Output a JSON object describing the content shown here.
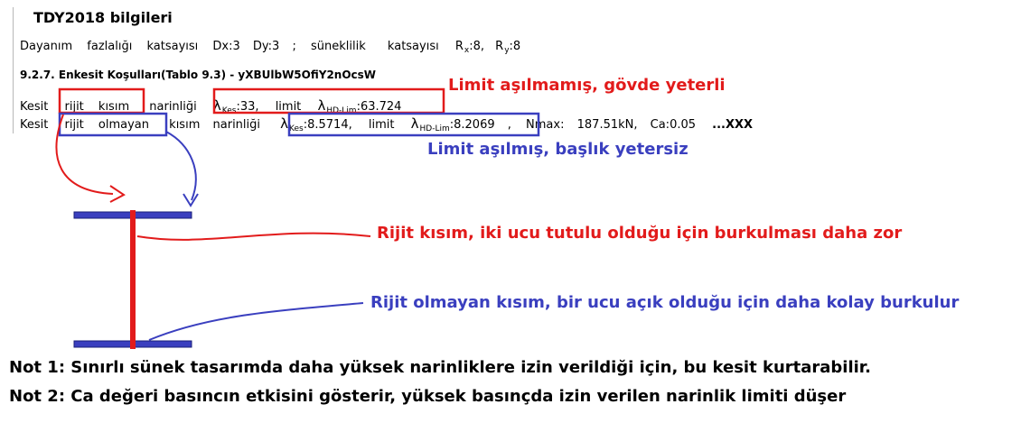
{
  "header": {
    "title": "TDY2018 bilgileri",
    "line1": {
      "label_words": [
        "Dayanım",
        "fazlalığı",
        "katsayısı"
      ],
      "dx": "Dx:3",
      "dy": "Dy:3",
      "sep": ";",
      "ductility_words": [
        "süneklilik",
        "katsayısı"
      ],
      "rx_label": "R",
      "rx_sub": "x",
      "rx_val": ":8,",
      "ry_label": "R",
      "ry_sub": "y",
      "ry_val": ":8"
    }
  },
  "section": {
    "title": "9.2.7. Enkesit Koşulları(Tablo 9.3)  - yXBUlbW5OfiY2nOcsW",
    "row_rigid": {
      "kesit": "Kesit",
      "w1": "rijit",
      "w2": "kısım",
      "narinligi": "narinliği",
      "lambda": "λ",
      "kes_sub": "Kes",
      "kes_val": ":33,",
      "limit": "limit",
      "hd_sub": "HD-Lim",
      "hd_val": ":63.724"
    },
    "row_nonrigid": {
      "kesit": "Kesit",
      "w1": "rijit",
      "w2": "olmayan",
      "w3": "kısım",
      "narinligi": "narinliği",
      "lambda": "λ",
      "kes_sub": "Kes",
      "kes_val": ":8.5714,",
      "limit": "limit",
      "hd_sub": "HD-Lim",
      "hd_val": ":8.2069",
      "comma": ",",
      "nmax": "Nmax:",
      "nmax_val": "187.51kN,",
      "ca": "Ca:0.05",
      "xxx": "...XXX"
    }
  },
  "annotations": {
    "limit_ok": "Limit aşılmamış, gövde yeterli",
    "limit_exceeded": "Limit aşılmış, başlık yetersiz",
    "rigid_note": "Rijit kısım, iki ucu tutulu olduğu için burkulması daha zor",
    "nonrigid_note": "Rijit olmayan kısım, bir ucu açık olduğu için daha kolay burkulur"
  },
  "notes": {
    "note1": "Not 1: Sınırlı sünek tasarımda daha yüksek narinliklere izin verildiği için, bu kesit kurtarabilir.",
    "note2": "Not 2: Ca değeri basıncın etkisini gösterir, yüksek basınçda izin verilen narinlik limiti düşer"
  },
  "colors": {
    "red": "#e21b1b",
    "blue": "#3a3fbf"
  }
}
